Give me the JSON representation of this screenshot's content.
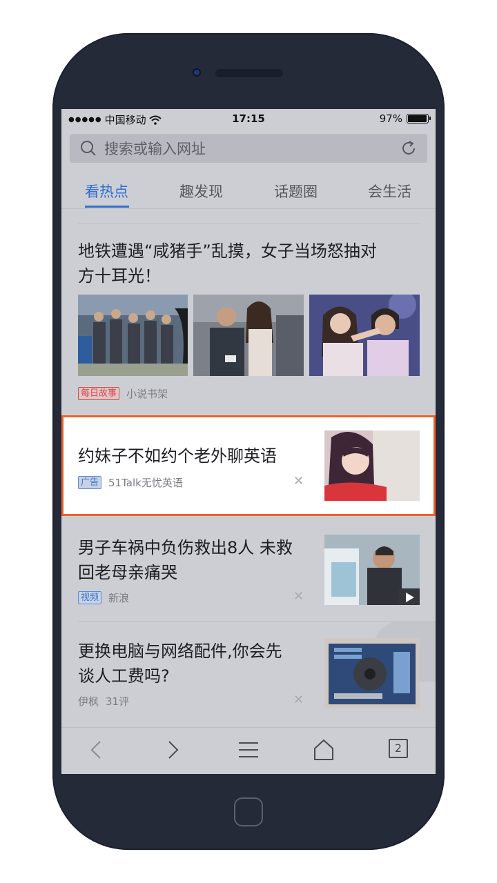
{
  "status": {
    "carrier": "中国移动",
    "time": "17:15",
    "battery": "97%",
    "battery_level": 0.97
  },
  "search": {
    "placeholder": "搜索或输入网址"
  },
  "tabs": [
    {
      "label": "看热点",
      "active": true
    },
    {
      "label": "趣发现",
      "active": false
    },
    {
      "label": "话题圈",
      "active": false
    },
    {
      "label": "会生活",
      "active": false
    }
  ],
  "feed": [
    {
      "title_line1": "地铁遭遇“咸猪手”乱摸，女子当场怒抽对",
      "title_line2": "方十耳光！",
      "badge": "每日故事",
      "source": "小说书架"
    },
    {
      "title": "约妹子不如约个老外聊英语",
      "badge": "广告",
      "source": "51Talk无忧英语",
      "highlight_color": "#f0612a"
    },
    {
      "title_line1": "男子车祸中负伤救出8人 未救",
      "title_line2": "回老母亲痛哭",
      "badge": "视频",
      "source": "新浪"
    },
    {
      "title_line1": "更换电脑与网络配件,你会先",
      "title_line2": "谈人工费吗?",
      "source": "伊枫",
      "comments": "31评"
    }
  ],
  "bottom_nav": {
    "tabs_count": "2"
  },
  "colors": {
    "accent": "#2e6fd1",
    "highlight": "#f0612a",
    "phone_body": "#252a39"
  }
}
